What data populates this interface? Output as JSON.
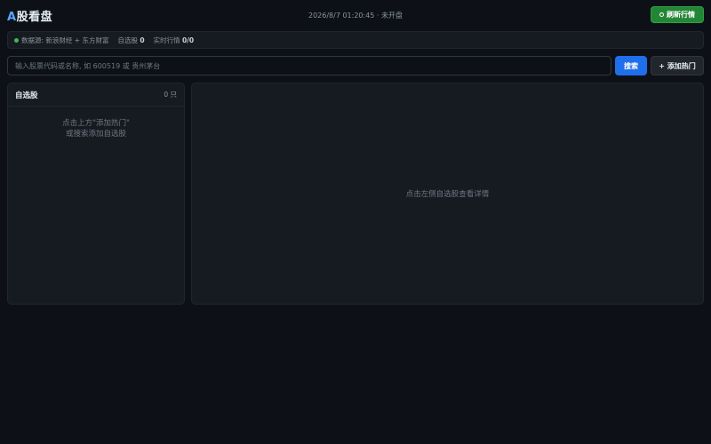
{
  "header": {
    "logo_accent": "A",
    "logo_rest": "股看盘",
    "clock": "2026/8/7 01:20:45 · 未开盘",
    "refresh_label": "刷新行情"
  },
  "status": {
    "source_label": "数据源: 新浪财经 + 东方财富",
    "watch_label": "自选股",
    "watch_count": "0",
    "realtime_label": "实时行情",
    "realtime_count": "0/0"
  },
  "search": {
    "placeholder": "输入股票代码或名称, 如 600519 或 贵州茅台",
    "value": "",
    "search_label": "搜索",
    "add_hot_label": "+ 添加热门"
  },
  "watchlist": {
    "title": "自选股",
    "count": "0 只",
    "empty_line1": "点击上方\"添加热门\"",
    "empty_line2": "或搜索添加自选股"
  },
  "detail": {
    "hint": "点击左侧自选股查看详情"
  },
  "colors": {
    "background": "#0d1117",
    "panel": "#161b22",
    "accent": "#58a6ff",
    "refresh_green": "#238636",
    "search_blue": "#1f6feb",
    "status_dot": "#3fb950"
  }
}
